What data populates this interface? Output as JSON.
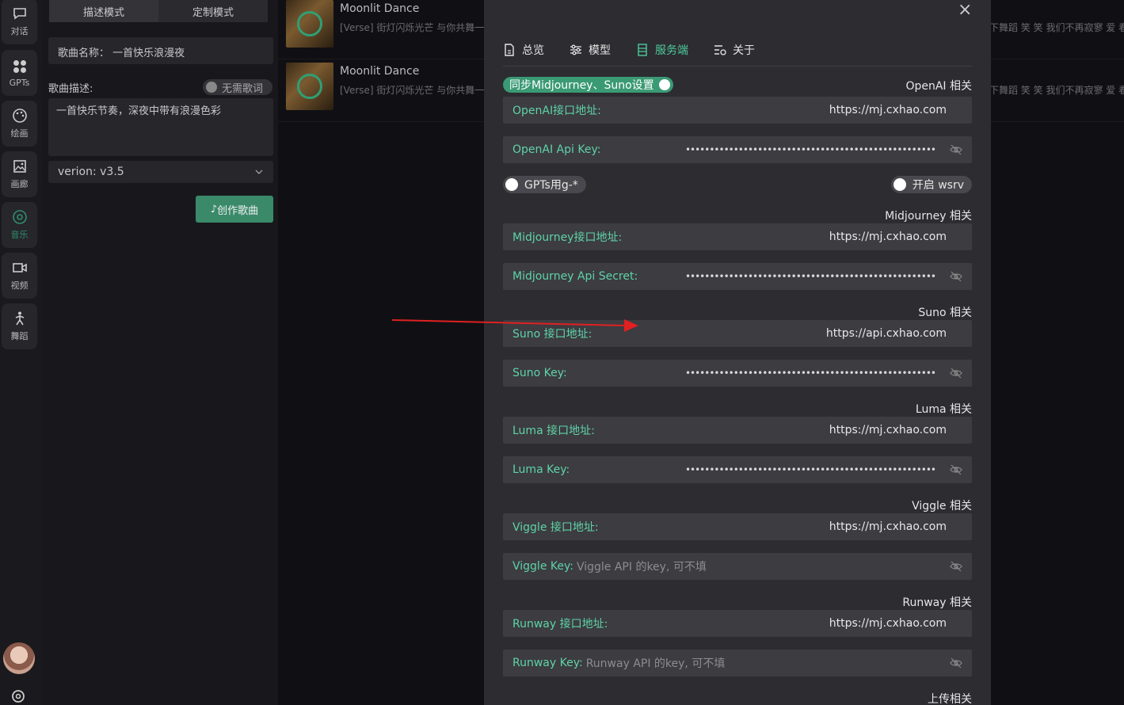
{
  "nav": {
    "items": [
      {
        "label": "对话",
        "icon": "chat-icon"
      },
      {
        "label": "GPTs",
        "icon": "grid-icon"
      },
      {
        "label": "绘画",
        "icon": "palette-icon"
      },
      {
        "label": "画廊",
        "icon": "image-icon"
      },
      {
        "label": "音乐",
        "icon": "music-icon"
      },
      {
        "label": "视频",
        "icon": "video-icon"
      },
      {
        "label": "舞蹈",
        "icon": "dance-icon"
      }
    ]
  },
  "music": {
    "mode_tabs": [
      "描述模式",
      "定制模式"
    ],
    "song_name": "歌曲名称： 一首快乐浪漫夜",
    "desc_label": "歌曲描述:",
    "no_lyrics": "无需歌词",
    "description": "一首快乐节奏，深夜中带有浪漫色彩",
    "version": "verion: v3.5",
    "create_button": "创作歌曲"
  },
  "songs": [
    {
      "title": "Moonlit Dance",
      "lyric": "[Verse] 街灯闪烁光芒 与你共舞一场",
      "lyric_tail": "下舞蹈 笑 笑 我们不再寂寥 爱 看"
    },
    {
      "title": "Moonlit Dance",
      "lyric": "[Verse] 街灯闪烁光芒 与你共舞一场",
      "lyric_tail": "下舞蹈 笑 笑 我们不再寂寥 爱 看"
    }
  ],
  "modal": {
    "tabs": [
      {
        "label": "总览",
        "icon": "document-icon"
      },
      {
        "label": "模型",
        "icon": "sliders-icon"
      },
      {
        "label": "服务端",
        "icon": "server-icon"
      },
      {
        "label": "关于",
        "icon": "info-settings-icon"
      }
    ],
    "sync_toggle": "同步Midjourney、Suno设置",
    "sections": {
      "openai": "OpenAI 相关",
      "midjourney": "Midjourney 相关",
      "suno": "Suno 相关",
      "luma": "Luma 相关",
      "viggle": "Viggle 相关",
      "runway": "Runway 相关",
      "upload": "上传相关"
    },
    "fields": {
      "openai_url_label": "OpenAI接口地址:",
      "openai_url": "https://mj.cxhao.com",
      "openai_key_label": "OpenAI Api Key:",
      "masked": "••••••••••••••••••••••••••••••••••••••••••••••••••••",
      "gpts_toggle": "GPTs用g-*",
      "wsrv_toggle": "开启 wsrv",
      "mj_url_label": "Midjourney接口地址:",
      "mj_url": "https://mj.cxhao.com",
      "mj_secret_label": "Midjourney Api Secret:",
      "suno_url_label": "Suno 接口地址:",
      "suno_url": "https://api.cxhao.com",
      "suno_key_label": "Suno Key:",
      "luma_url_label": "Luma 接口地址:",
      "luma_url": "https://mj.cxhao.com",
      "luma_key_label": "Luma Key:",
      "viggle_url_label": "Viggle 接口地址:",
      "viggle_url": "https://mj.cxhao.com",
      "viggle_key_label": "Viggle Key:",
      "viggle_key_placeholder": "Viggle API 的key, 可不填",
      "runway_url_label": "Runway 接口地址:",
      "runway_url": "https://mj.cxhao.com",
      "runway_key_label": "Runway Key:",
      "runway_key_placeholder": "Runway API 的key, 可不填"
    }
  },
  "colors": {
    "accent": "#4fc99a",
    "toggle_on": "#3a9a74",
    "arrow": "#e02020"
  }
}
